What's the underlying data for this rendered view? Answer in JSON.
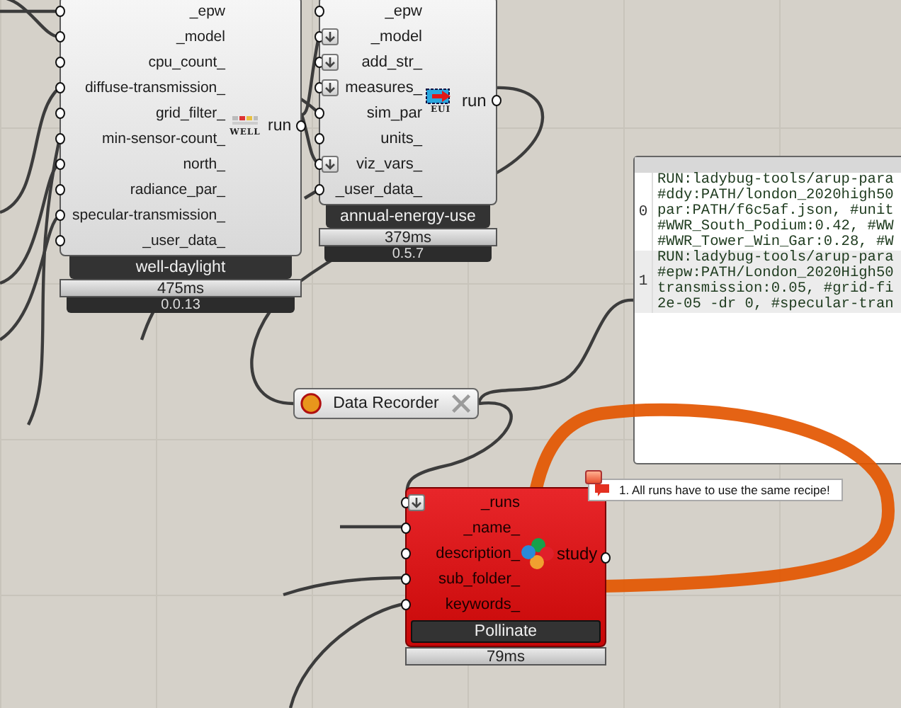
{
  "nodes": [
    {
      "kind": "component",
      "title": "well-daylight",
      "error": false,
      "icon_text": "WELL",
      "inputs": [
        {
          "label": "_epw",
          "flatten": false
        },
        {
          "label": "_model",
          "flatten": false
        },
        {
          "label": "cpu_count_",
          "flatten": false
        },
        {
          "label": "diffuse-transmission_",
          "flatten": false
        },
        {
          "label": "grid_filter_",
          "flatten": false
        },
        {
          "label": "min-sensor-count_",
          "flatten": false
        },
        {
          "label": "north_",
          "flatten": false
        },
        {
          "label": "radiance_par_",
          "flatten": false
        },
        {
          "label": "specular-transmission_",
          "flatten": false
        },
        {
          "label": "_user_data_",
          "flatten": false
        }
      ],
      "outputs": [
        {
          "label": "run"
        }
      ],
      "timing": "475ms",
      "version": "0.0.13"
    },
    {
      "kind": "component",
      "title": "annual-energy-use",
      "error": false,
      "icon_text": "EUI",
      "inputs": [
        {
          "label": "_epw",
          "flatten": false
        },
        {
          "label": "_model",
          "flatten": true
        },
        {
          "label": "add_str_",
          "flatten": true
        },
        {
          "label": "measures_",
          "flatten": true
        },
        {
          "label": "sim_par",
          "flatten": false
        },
        {
          "label": "units_",
          "flatten": false
        },
        {
          "label": "viz_vars_",
          "flatten": true
        },
        {
          "label": "_user_data_",
          "flatten": false
        }
      ],
      "outputs": [
        {
          "label": "run"
        }
      ],
      "timing": "379ms",
      "version": "0.5.7"
    },
    {
      "kind": "component",
      "title": "Pollinate",
      "error": true,
      "inputs": [
        {
          "label": "_runs",
          "flatten": true
        },
        {
          "label": "_name_",
          "flatten": false
        },
        {
          "label": "description_",
          "flatten": false
        },
        {
          "label": "sub_folder_",
          "flatten": false
        },
        {
          "label": "keywords_",
          "flatten": false
        }
      ],
      "outputs": [
        {
          "label": "study"
        }
      ],
      "timing": "79ms"
    }
  ],
  "recorder": {
    "label": "Data Recorder"
  },
  "panel": {
    "items": [
      {
        "index": "0",
        "lines": [
          "RUN:ladybug-tools/arup-para",
          "#ddy:PATH/london_2020high50",
          "par:PATH/f6c5af.json, #unit",
          "#WWR_South_Podium:0.42, #WW",
          "#WWR_Tower_Win_Gar:0.28, #W"
        ]
      },
      {
        "index": "1",
        "lines": [
          "RUN:ladybug-tools/arup-para",
          "#epw:PATH/London_2020High50",
          "transmission:0.05, #grid-fi",
          "2e-05 -dr 0, #specular-tran"
        ]
      }
    ]
  },
  "message": {
    "text": "1. All runs have to use the same recipe!"
  }
}
